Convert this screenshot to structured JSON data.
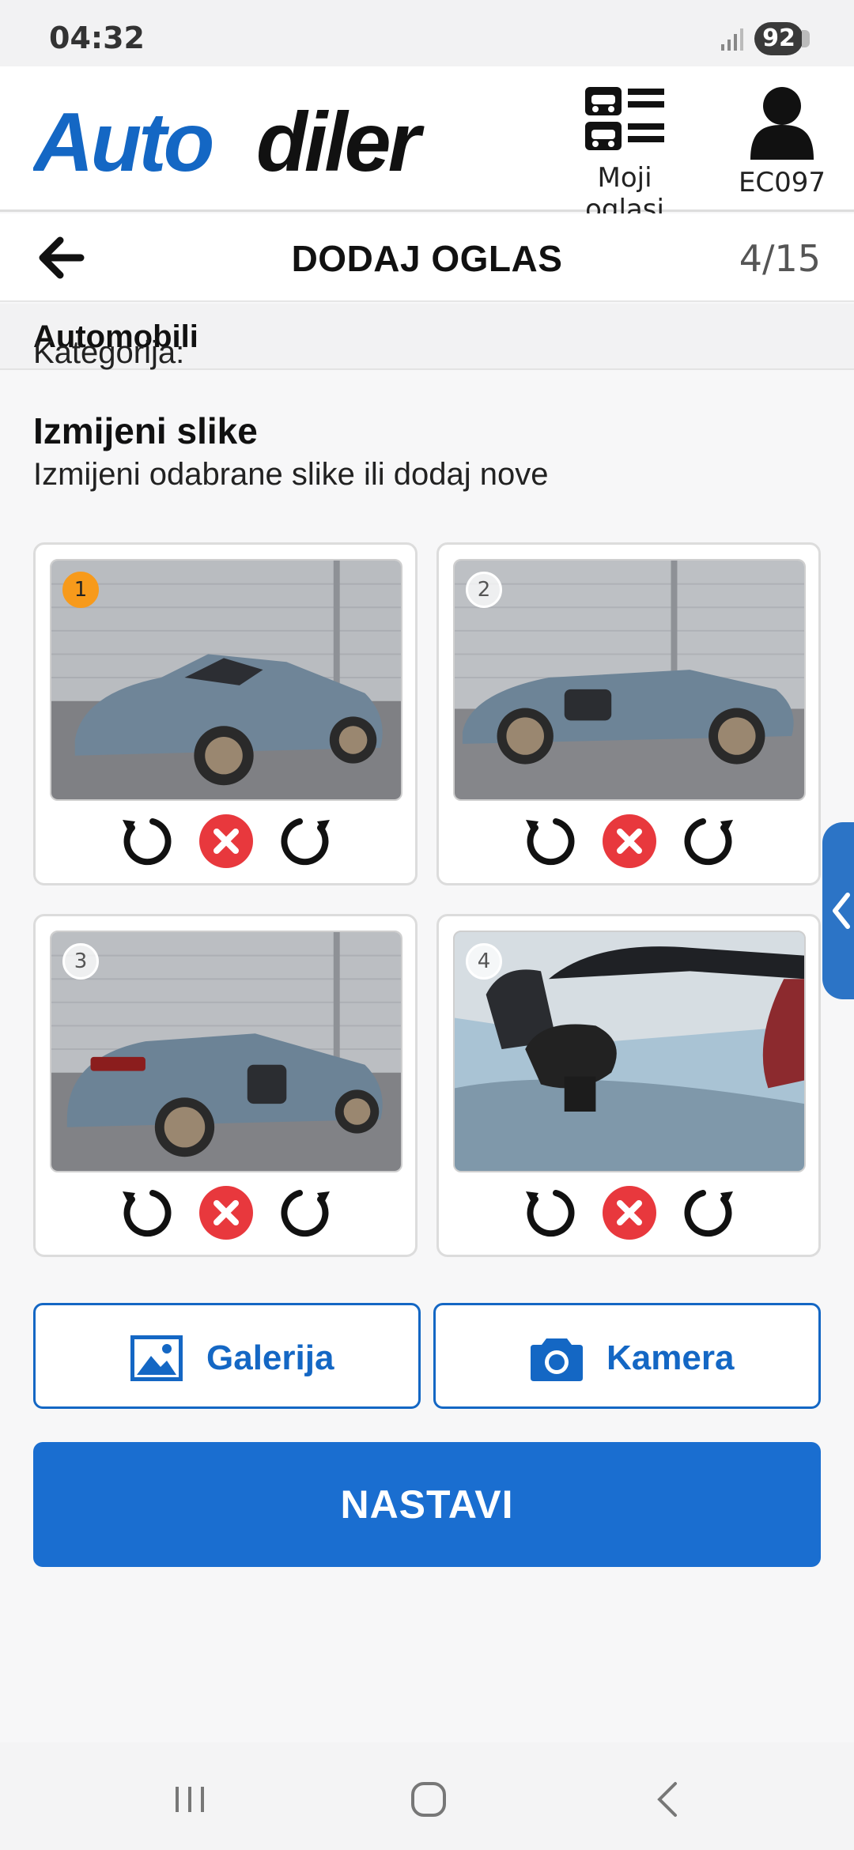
{
  "status": {
    "time": "04:32",
    "battery": "92"
  },
  "header": {
    "logo_text_auto": "Auto",
    "logo_text_diler": "diler",
    "my_ads_label": "Moji oglasi",
    "user_label": "EC097"
  },
  "page": {
    "title": "DODAJ OGLAS",
    "step": "4/15"
  },
  "category": {
    "label": "Kategorija:",
    "value": "Automobili"
  },
  "section": {
    "title": "Izmijeni slike",
    "subtitle": "Izmijeni odabrane slike ili dodaj nove"
  },
  "photos": [
    {
      "number": "1",
      "primary": true
    },
    {
      "number": "2",
      "primary": false
    },
    {
      "number": "3",
      "primary": false
    },
    {
      "number": "4",
      "primary": false
    }
  ],
  "buttons": {
    "gallery": "Galerija",
    "camera": "Kamera",
    "continue": "NASTAVI"
  },
  "colors": {
    "brand_blue": "#1467c4",
    "primary_badge": "#f79a1b",
    "delete_red": "#e8383d"
  },
  "icons": [
    "signal-icon",
    "car-list-icon",
    "user-icon",
    "back-arrow-icon",
    "rotate-left-icon",
    "delete-icon",
    "rotate-right-icon",
    "gallery-icon",
    "camera-icon",
    "chevron-left-icon",
    "recent-apps-icon",
    "home-icon",
    "nav-back-icon"
  ]
}
